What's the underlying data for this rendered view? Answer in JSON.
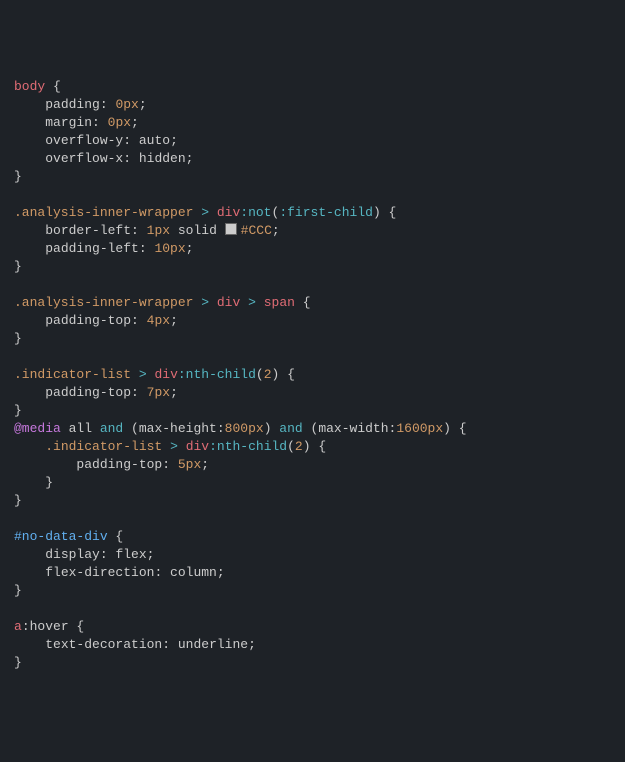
{
  "rules": [
    {
      "selector": [
        {
          "cls": "sel-tag",
          "t": "body"
        }
      ],
      "decls": [
        {
          "prop": "padding",
          "val": "0px",
          "valcls": "val"
        },
        {
          "prop": "margin",
          "val": "0px",
          "valcls": "val"
        },
        {
          "prop": "overflow-y",
          "val": "auto",
          "valcls": "ident"
        },
        {
          "prop": "overflow-x",
          "val": "hidden",
          "valcls": "ident"
        }
      ]
    },
    {
      "selector": [
        {
          "cls": "sel-class",
          "t": ".analysis-inner-wrapper"
        },
        {
          "cls": "punct",
          "t": " "
        },
        {
          "cls": "combin",
          "t": ">"
        },
        {
          "cls": "punct",
          "t": " "
        },
        {
          "cls": "sel-tag",
          "t": "div"
        },
        {
          "cls": "func",
          "t": ":not"
        },
        {
          "cls": "punct",
          "t": "("
        },
        {
          "cls": "func",
          "t": ":first-child"
        },
        {
          "cls": "punct",
          "t": ")"
        }
      ],
      "decls": [
        {
          "prop": "border-left",
          "val_pre": "1px",
          "val_mid": " solid ",
          "swatch": "#CCC",
          "val_post": "#CCC"
        },
        {
          "prop": "padding-left",
          "val": "10px",
          "valcls": "val"
        }
      ]
    },
    {
      "selector": [
        {
          "cls": "sel-class",
          "t": ".analysis-inner-wrapper"
        },
        {
          "cls": "punct",
          "t": " "
        },
        {
          "cls": "combin",
          "t": ">"
        },
        {
          "cls": "punct",
          "t": " "
        },
        {
          "cls": "sel-tag",
          "t": "div"
        },
        {
          "cls": "punct",
          "t": " "
        },
        {
          "cls": "combin",
          "t": ">"
        },
        {
          "cls": "punct",
          "t": " "
        },
        {
          "cls": "sel-tag",
          "t": "span"
        }
      ],
      "decls": [
        {
          "prop": "padding-top",
          "val": "4px",
          "valcls": "val"
        }
      ]
    },
    {
      "selector": [
        {
          "cls": "sel-class",
          "t": ".indicator-list"
        },
        {
          "cls": "punct",
          "t": " "
        },
        {
          "cls": "combin",
          "t": ">"
        },
        {
          "cls": "punct",
          "t": " "
        },
        {
          "cls": "sel-tag",
          "t": "div"
        },
        {
          "cls": "func",
          "t": ":nth-child"
        },
        {
          "cls": "punct",
          "t": "("
        },
        {
          "cls": "val",
          "t": "2"
        },
        {
          "cls": "punct",
          "t": ")"
        }
      ],
      "decls": [
        {
          "prop": "padding-top",
          "val": "7px",
          "valcls": "val"
        }
      ]
    },
    {
      "at_media": {
        "kw": "@media",
        "tokens": [
          {
            "cls": "ident",
            "t": " all "
          },
          {
            "cls": "op-and",
            "t": "and"
          },
          {
            "cls": "media-q",
            "t": " ("
          },
          {
            "cls": "prop",
            "t": "max-height"
          },
          {
            "cls": "media-q",
            "t": ":"
          },
          {
            "cls": "val",
            "t": "800px"
          },
          {
            "cls": "media-q",
            "t": ") "
          },
          {
            "cls": "op-and",
            "t": "and"
          },
          {
            "cls": "media-q",
            "t": " ("
          },
          {
            "cls": "prop",
            "t": "max-width"
          },
          {
            "cls": "media-q",
            "t": ":"
          },
          {
            "cls": "val",
            "t": "1600px"
          },
          {
            "cls": "media-q",
            "t": ")"
          }
        ],
        "inner": {
          "selector": [
            {
              "cls": "sel-class",
              "t": ".indicator-list"
            },
            {
              "cls": "punct",
              "t": " "
            },
            {
              "cls": "combin",
              "t": ">"
            },
            {
              "cls": "punct",
              "t": " "
            },
            {
              "cls": "sel-tag",
              "t": "div"
            },
            {
              "cls": "func",
              "t": ":nth-child"
            },
            {
              "cls": "punct",
              "t": "("
            },
            {
              "cls": "val",
              "t": "2"
            },
            {
              "cls": "punct",
              "t": ")"
            }
          ],
          "decls": [
            {
              "prop": "padding-top",
              "val": "5px",
              "valcls": "val"
            }
          ]
        }
      }
    },
    {
      "selector": [
        {
          "cls": "sel-id",
          "t": "#no-data-div"
        }
      ],
      "decls": [
        {
          "prop": "display",
          "val": "flex",
          "valcls": "ident"
        },
        {
          "prop": "flex-direction",
          "val": "column",
          "valcls": "ident"
        }
      ]
    },
    {
      "selector": [
        {
          "cls": "sel-tag",
          "t": "a"
        },
        {
          "cls": "pseudo-cls",
          "t": ":hover"
        }
      ],
      "decls": [
        {
          "prop": "text-decoration",
          "val": "underline",
          "valcls": "ident"
        }
      ]
    }
  ],
  "punct": {
    "open": " {",
    "close": "}",
    "colon": ": ",
    "semi": ";"
  },
  "indent": "    "
}
